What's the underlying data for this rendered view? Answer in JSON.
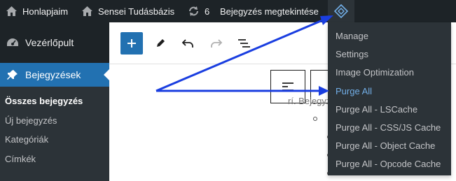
{
  "adminbar": {
    "site_name": "Honlapjaim",
    "site_link": "Sensei Tudásbázis",
    "updates_count": "6",
    "view_post": "Bejegyzés megtekintése",
    "lscache_icon": "lscache-diamond-icon"
  },
  "sidebar": {
    "dashboard": "Vezérlőpult",
    "posts": "Bejegyzések",
    "submenu": [
      "Összes bejegyzés",
      "Új bejegyzés",
      "Kategóriák",
      "Címkék"
    ]
  },
  "editor": {
    "content_snippet": "rí. Bejegyzés"
  },
  "dropdown": {
    "items": [
      "Manage",
      "Settings",
      "Image Optimization",
      "Purge All",
      "Purge All - LSCache",
      "Purge All - CSS/JS Cache",
      "Purge All - Object Cache",
      "Purge All - Opcode Cache"
    ],
    "hover_color": "#72aee6"
  },
  "colors": {
    "adminbar": "#1d2327",
    "accent": "#2271b1",
    "annotation_arrow": "#1a3ee0"
  }
}
